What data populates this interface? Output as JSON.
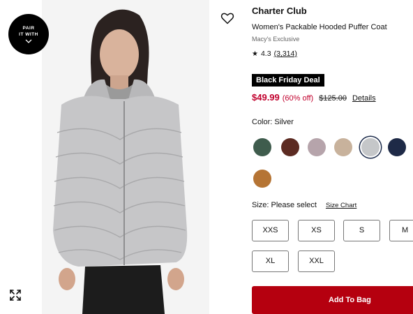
{
  "image_panel": {
    "pair_badge_line1": "PAIR",
    "pair_badge_line2": "IT WITH",
    "icons": [
      "heart-icon",
      "expand-icon",
      "chevron-down-icon"
    ]
  },
  "product": {
    "brand": "Charter Club",
    "title": "Women's Packable Hooded Puffer Coat",
    "exclusive": "Macy's Exclusive",
    "rating": "4.3",
    "review_count": "(3,314)",
    "deal_badge": "Black Friday Deal",
    "sale_price": "$49.99",
    "discount": "(60% off)",
    "original_price": "$125.00",
    "details_link": "Details"
  },
  "colors": {
    "label": "Color: Silver",
    "swatches": [
      {
        "name": "green",
        "hex": "#3f5c4d"
      },
      {
        "name": "brown",
        "hex": "#5c2b22"
      },
      {
        "name": "mauve",
        "hex": "#b6a4ab"
      },
      {
        "name": "taupe",
        "hex": "#c8b29c"
      },
      {
        "name": "silver",
        "hex": "#c5c7c9",
        "selected": true
      },
      {
        "name": "navy",
        "hex": "#1e2a47"
      },
      {
        "name": "camel",
        "hex": "#b57434"
      }
    ]
  },
  "sizes": {
    "label": "Size: Please select",
    "chart_link": "Size Chart",
    "options": [
      "XXS",
      "XS",
      "S",
      "M",
      "XL",
      "XXL"
    ]
  },
  "cta": {
    "add_to_bag": "Add To Bag"
  }
}
